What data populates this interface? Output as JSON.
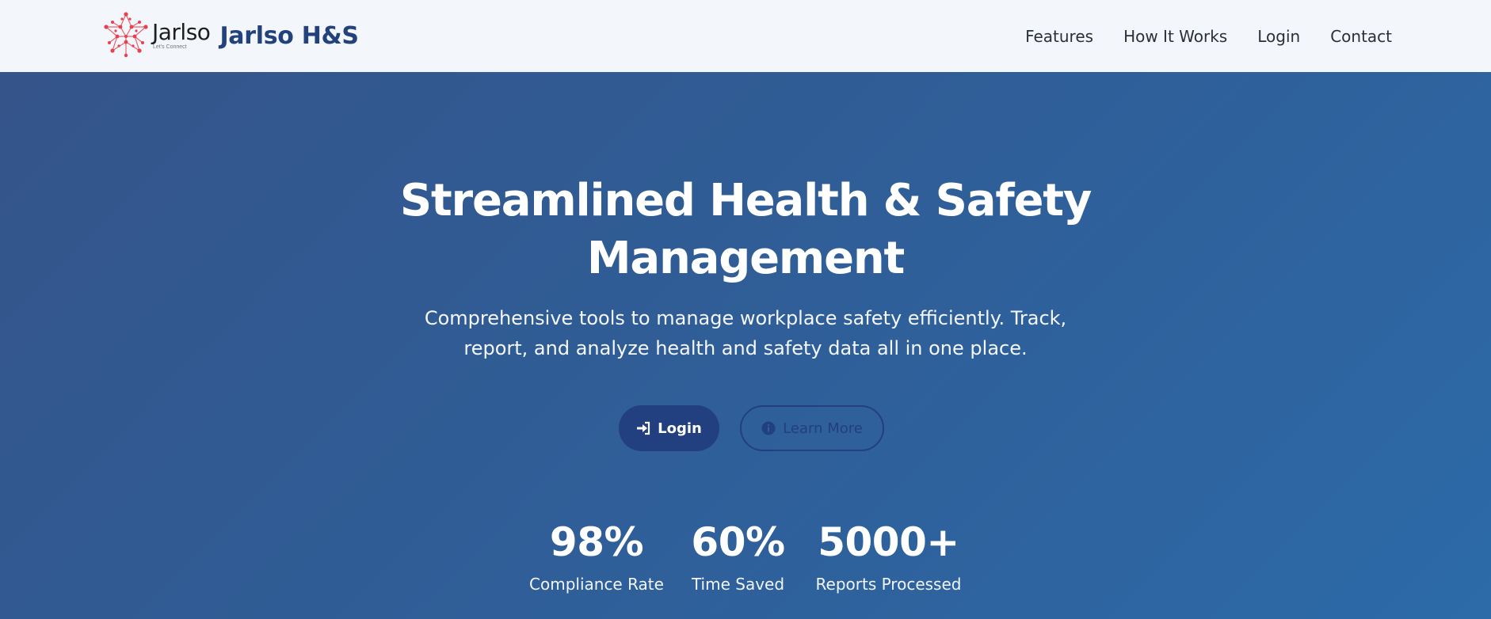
{
  "header": {
    "logo": {
      "word": "Jarlso",
      "tagline": "Let's Connect"
    },
    "brand_name": "Jarlso H&S",
    "nav": [
      {
        "label": "Features"
      },
      {
        "label": "How It Works"
      },
      {
        "label": "Login"
      },
      {
        "label": "Contact"
      }
    ]
  },
  "hero": {
    "title_line1": "Streamlined Health & Safety",
    "title_line2": "Management",
    "subtitle_line1": "Comprehensive tools to manage workplace safety efficiently. Track,",
    "subtitle_line2": "report, and analyze health and safety data all in one place.",
    "primary_button": {
      "label": "Login",
      "icon": "sign-in-icon"
    },
    "secondary_button": {
      "label": "Learn More",
      "icon": "info-circle-icon"
    }
  },
  "stats": [
    {
      "value": "98%",
      "label": "Compliance Rate"
    },
    {
      "value": "60%",
      "label": "Time Saved"
    },
    {
      "value": "5000+",
      "label": "Reports Processed"
    }
  ],
  "colors": {
    "navbar_bg": "#f3f6fa",
    "brand": "#23427c",
    "hero_gradient_start": "#34548a",
    "hero_gradient_end": "#2c6aa8",
    "primary_button": "#223f80",
    "logo_accent": "#e5414f"
  }
}
